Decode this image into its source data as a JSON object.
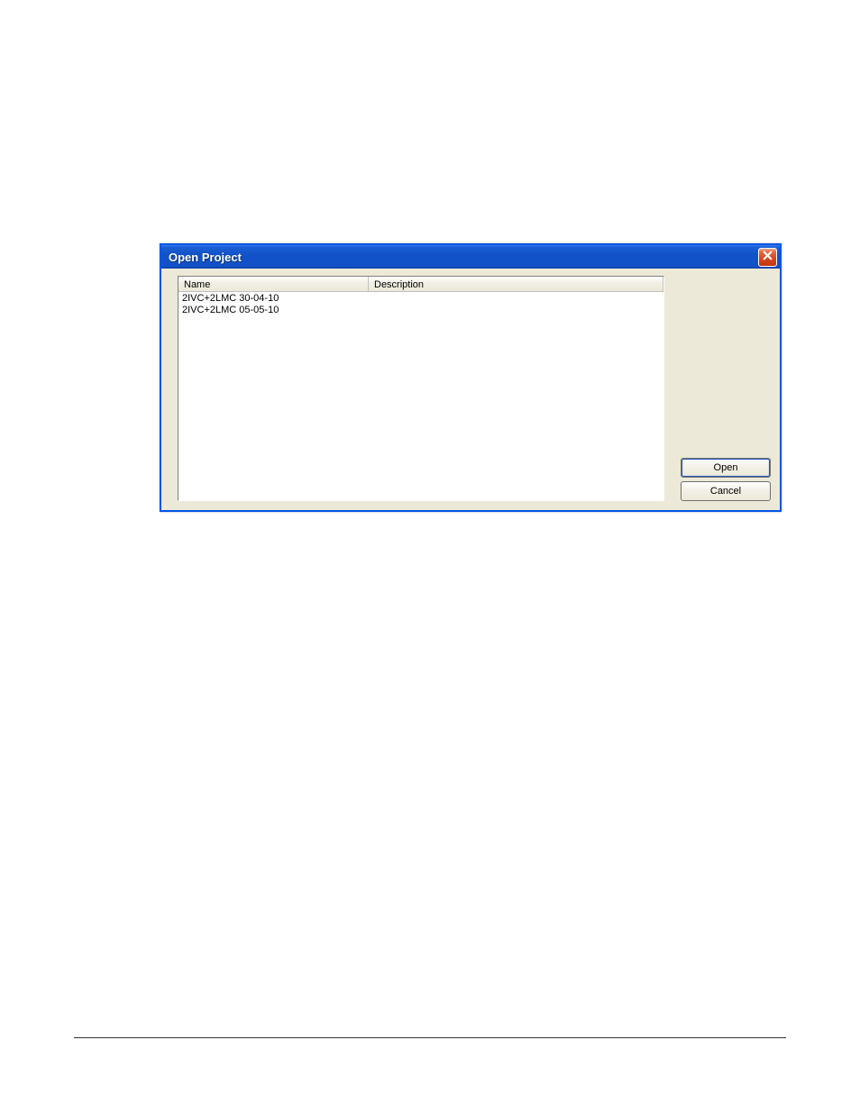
{
  "dialog": {
    "title": "Open Project",
    "columns": {
      "name": "Name",
      "description": "Description"
    },
    "rows": [
      {
        "name": "2IVC+2LMC 30-04-10",
        "description": ""
      },
      {
        "name": "2IVC+2LMC 05-05-10",
        "description": ""
      }
    ],
    "buttons": {
      "open": "Open",
      "cancel": "Cancel"
    }
  }
}
